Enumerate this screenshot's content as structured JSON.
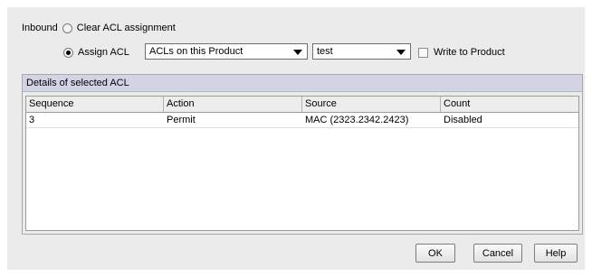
{
  "inbound": {
    "label": "Inbound",
    "clear_option_label": "Clear ACL assignment",
    "assign_option_label": "Assign ACL"
  },
  "acl_source_select": {
    "value": "ACLs on this Product"
  },
  "acl_name_select": {
    "value": "test"
  },
  "write_to_product": {
    "label": "Write to Product",
    "checked": false
  },
  "details": {
    "title": "Details of selected ACL",
    "columns": [
      "Sequence",
      "Action",
      "Source",
      "Count"
    ],
    "rows": [
      [
        "3",
        "Permit",
        "MAC (2323.2342.2423)",
        "Disabled"
      ]
    ]
  },
  "buttons": {
    "ok": "OK",
    "cancel": "Cancel",
    "help": "Help"
  }
}
